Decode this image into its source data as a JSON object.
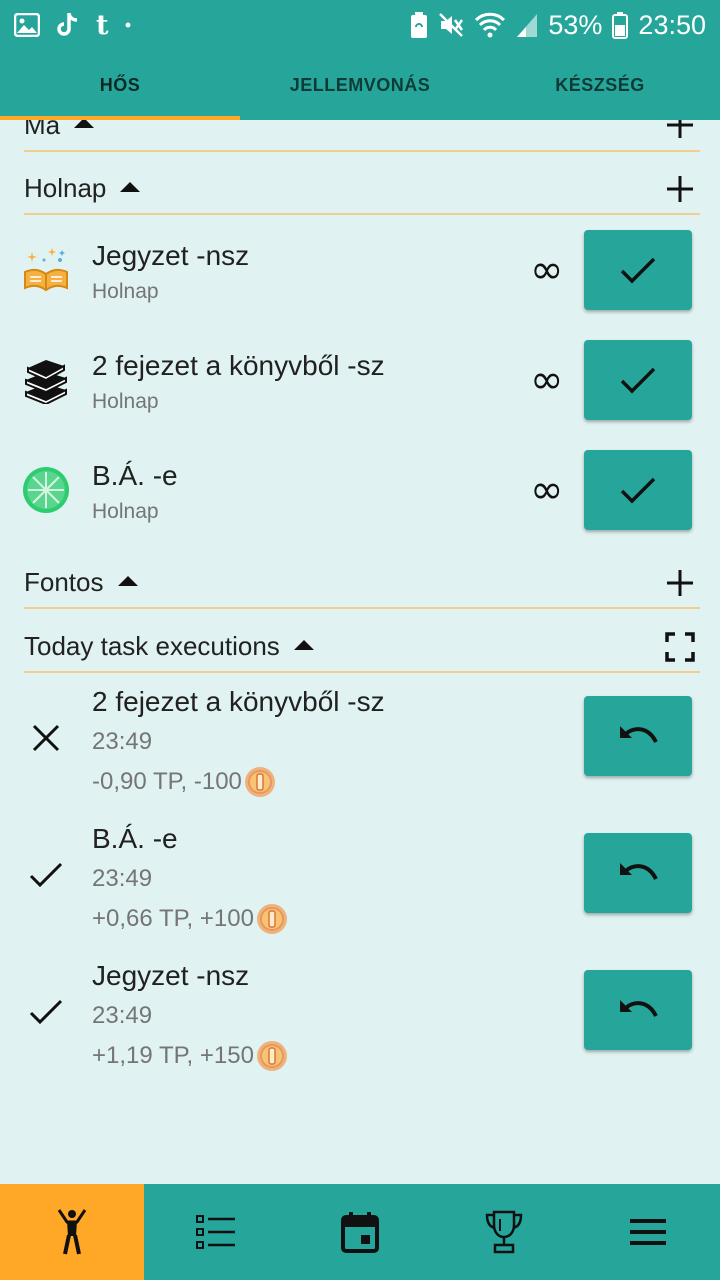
{
  "status_bar": {
    "battery": "53%",
    "time": "23:50",
    "left_icons": [
      "image-icon",
      "tiktok-icon",
      "tumblr-icon",
      "dot-icon"
    ],
    "right_icons": [
      "battery-saver-icon",
      "mute-icon",
      "wifi-icon",
      "signal-icon",
      "battery-icon"
    ]
  },
  "tabs": [
    {
      "label": "HŐS",
      "active": true
    },
    {
      "label": "JELLEMVONÁS",
      "active": false
    },
    {
      "label": "KÉSZSÉG",
      "active": false
    }
  ],
  "sections": {
    "ma": {
      "title": "Ma"
    },
    "holnap": {
      "title": "Holnap"
    },
    "fontos": {
      "title": "Fontos"
    },
    "executions": {
      "title": "Today task executions"
    }
  },
  "tasks": [
    {
      "title": "Jegyzet -nsz",
      "subtitle": "Holnap",
      "repeat": "∞",
      "icon": "book-stars-icon"
    },
    {
      "title": "2 fejezet a könyvből -sz",
      "subtitle": "Holnap",
      "repeat": "∞",
      "icon": "books-stack-icon"
    },
    {
      "title": "B.Á. -e",
      "subtitle": "Holnap",
      "repeat": "∞",
      "icon": "lime-icon"
    }
  ],
  "executions": [
    {
      "title": "2 fejezet a könyvből -sz",
      "time": "23:49",
      "reward": "-0,90 TP, -100",
      "status": "failed"
    },
    {
      "title": "B.Á. -e",
      "time": "23:49",
      "reward": "+0,66 TP, +100",
      "status": "done"
    },
    {
      "title": "Jegyzet -nsz",
      "time": "23:49",
      "reward": "+1,19 TP, +150",
      "status": "done"
    }
  ],
  "bottom_nav": [
    {
      "icon": "hero-icon",
      "active": true
    },
    {
      "icon": "task-list-icon",
      "active": false
    },
    {
      "icon": "calendar-icon",
      "active": false
    },
    {
      "icon": "trophy-icon",
      "active": false
    },
    {
      "icon": "menu-icon",
      "active": false
    }
  ],
  "colors": {
    "primary": "#26a69a",
    "accent": "#ffa726",
    "background": "#e0f2f1",
    "divider": "#f0cf8c"
  }
}
